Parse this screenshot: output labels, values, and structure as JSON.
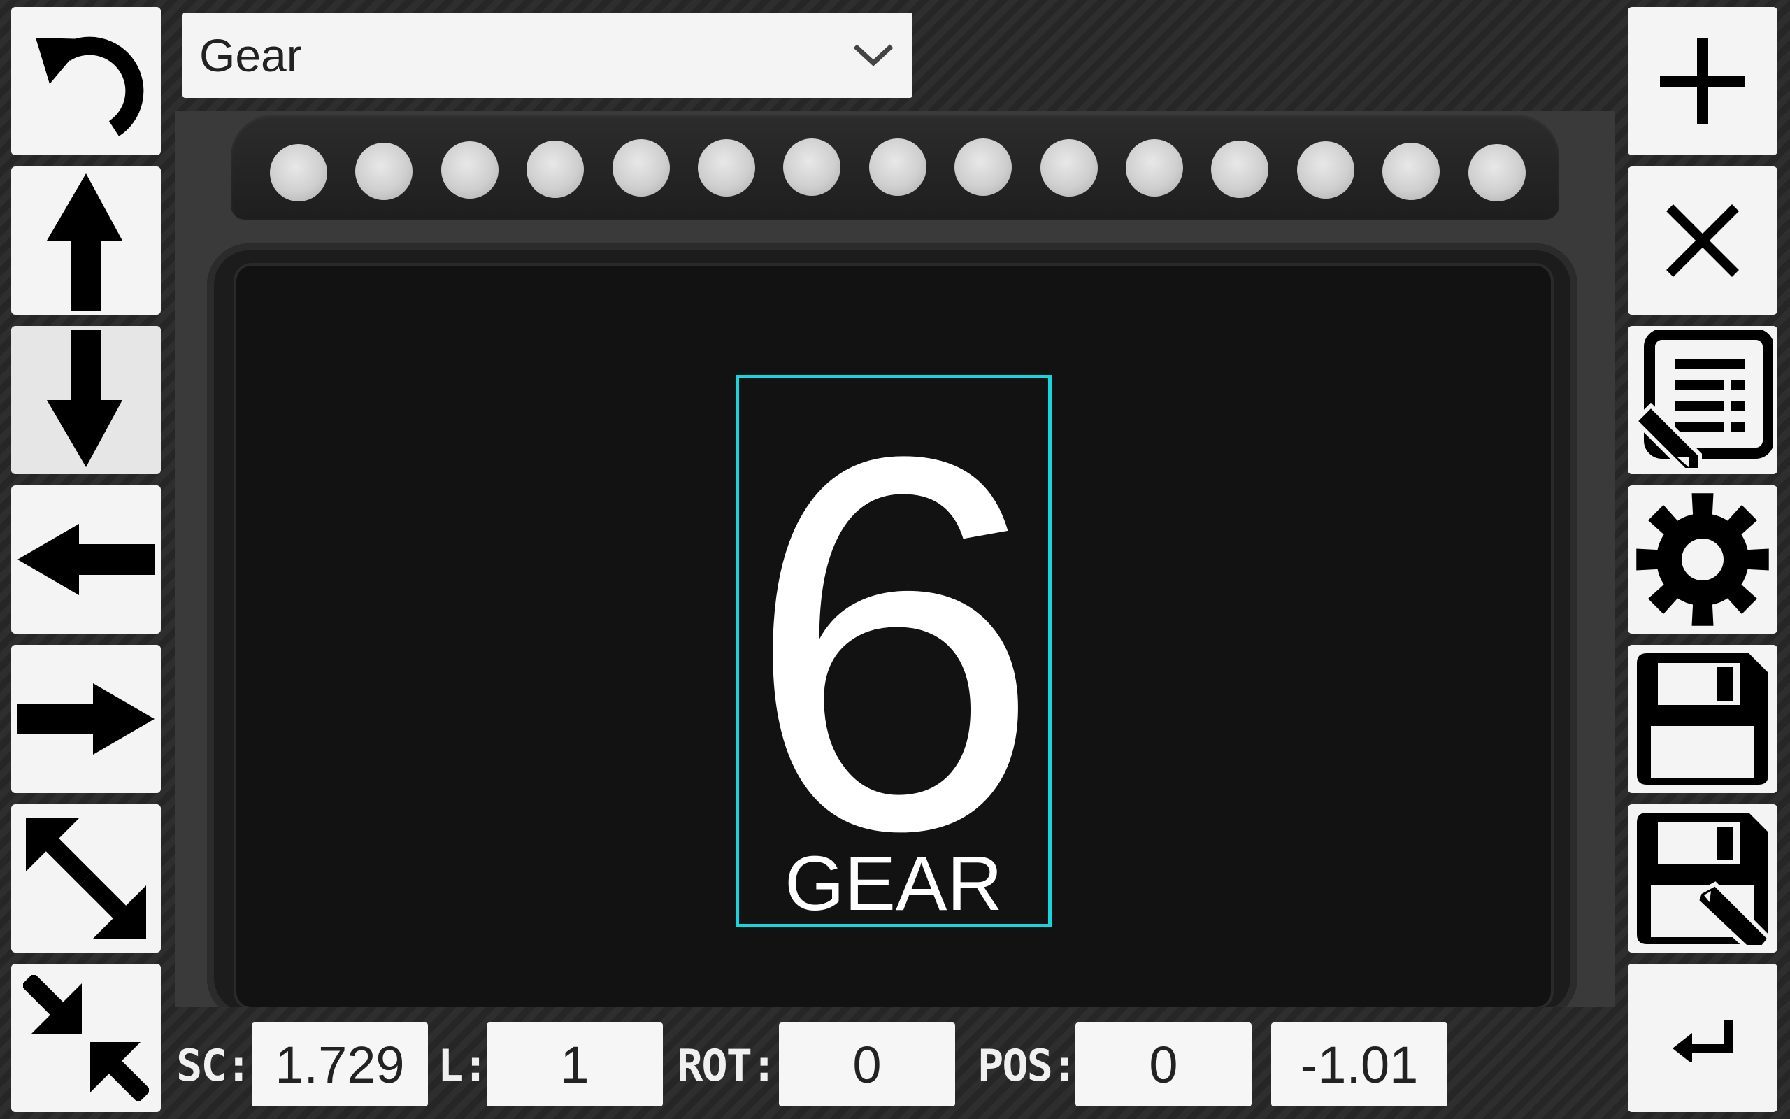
{
  "dropdown": {
    "selected": "Gear"
  },
  "left_toolbar": {
    "icons": [
      "undo-icon",
      "arrow-up-icon",
      "arrow-down-icon",
      "arrow-left-icon",
      "arrow-right-icon",
      "expand-icon",
      "shrink-icon"
    ]
  },
  "right_toolbar": {
    "icons": [
      "plus-icon",
      "close-icon",
      "edit-list-icon",
      "gear-icon",
      "save-icon",
      "save-as-icon",
      "back-icon"
    ]
  },
  "gauge": {
    "value": "6",
    "label": "GEAR",
    "selection_color": "#18d4dc",
    "led_count": 15
  },
  "bottom_bar": {
    "sc_label": "SC:",
    "sc_value": "1.729",
    "l_label": "L:",
    "l_value": "1",
    "rot_label": "ROT:",
    "rot_value": "0",
    "pos_label": "POS:",
    "pos_x": "0",
    "pos_y": "-1.01"
  }
}
